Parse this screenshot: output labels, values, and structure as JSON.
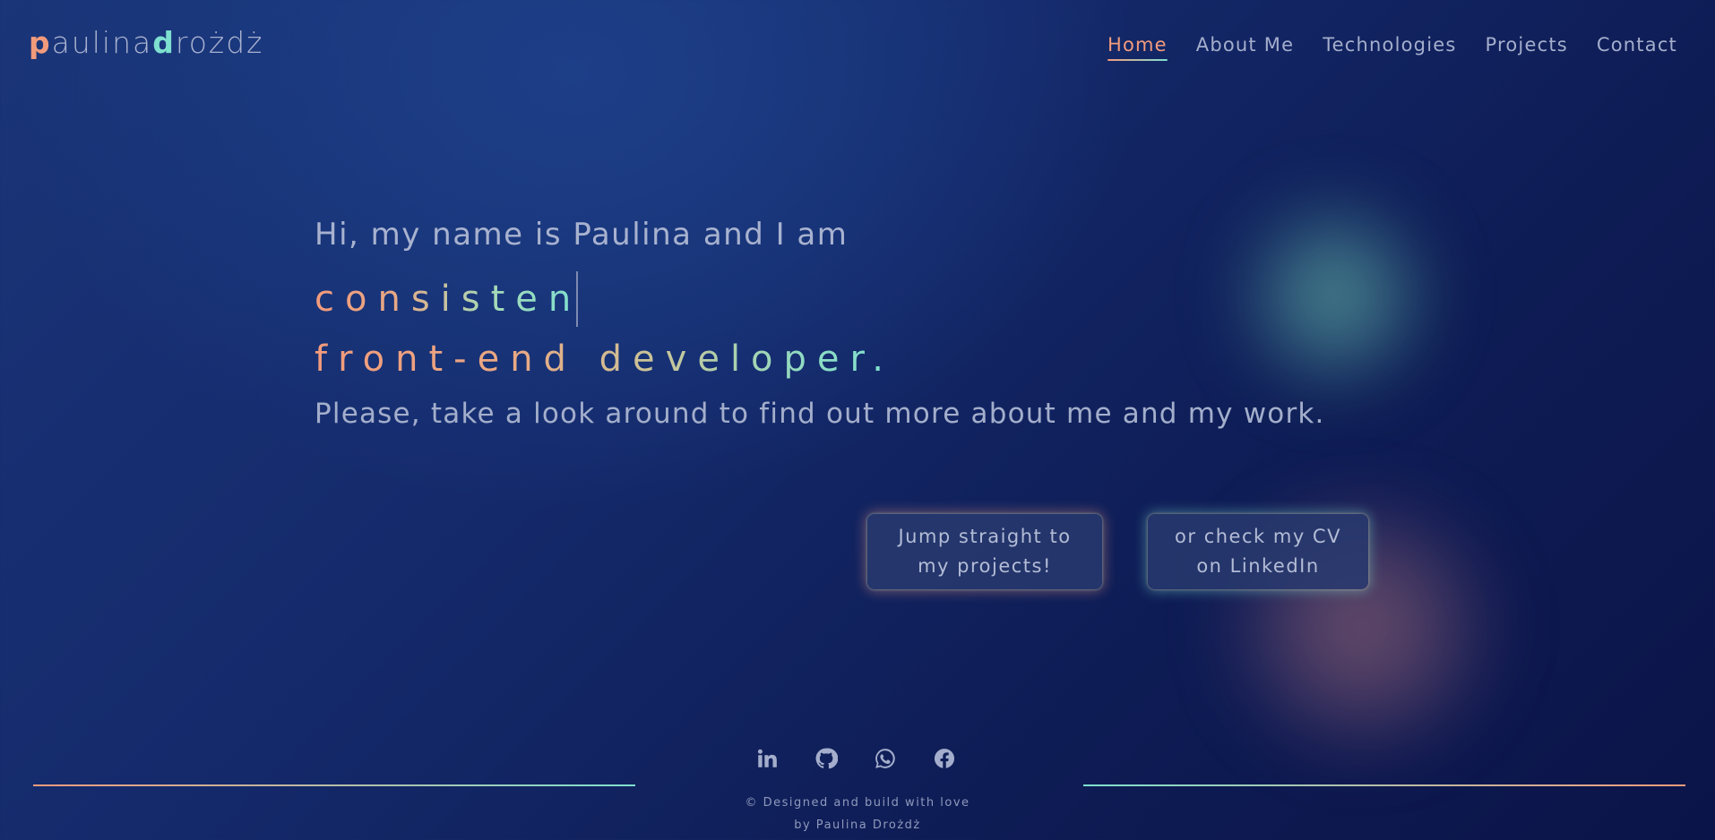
{
  "logo": {
    "first_initial": "p",
    "first_rest": "aulina",
    "last_initial": "d",
    "last_rest": "rożdż"
  },
  "nav": {
    "items": [
      {
        "label": "Home",
        "active": true
      },
      {
        "label": "About Me",
        "active": false
      },
      {
        "label": "Technologies",
        "active": false
      },
      {
        "label": "Projects",
        "active": false
      },
      {
        "label": "Contact",
        "active": false
      }
    ]
  },
  "hero": {
    "greeting": "Hi, my name is Paulina and I am",
    "typed_word": "consisten",
    "role": "front-end developer.",
    "subtitle": "Please, take a look around to find out more about me and my work."
  },
  "buttons": {
    "projects": {
      "line1": "Jump straight to",
      "line2": "my projects!"
    },
    "linkedin": {
      "line1": "or check my CV",
      "line2": "on LinkedIn"
    }
  },
  "footer": {
    "socials": [
      "linkedin-icon",
      "github-icon",
      "whatsapp-icon",
      "facebook-icon"
    ],
    "credit_line1": "© Designed and build with love",
    "credit_line2": "by Paulina Drożdż"
  },
  "colors": {
    "accent_coral": "#f29b7c",
    "accent_teal": "#7ee0d0",
    "background": "#14296a"
  }
}
